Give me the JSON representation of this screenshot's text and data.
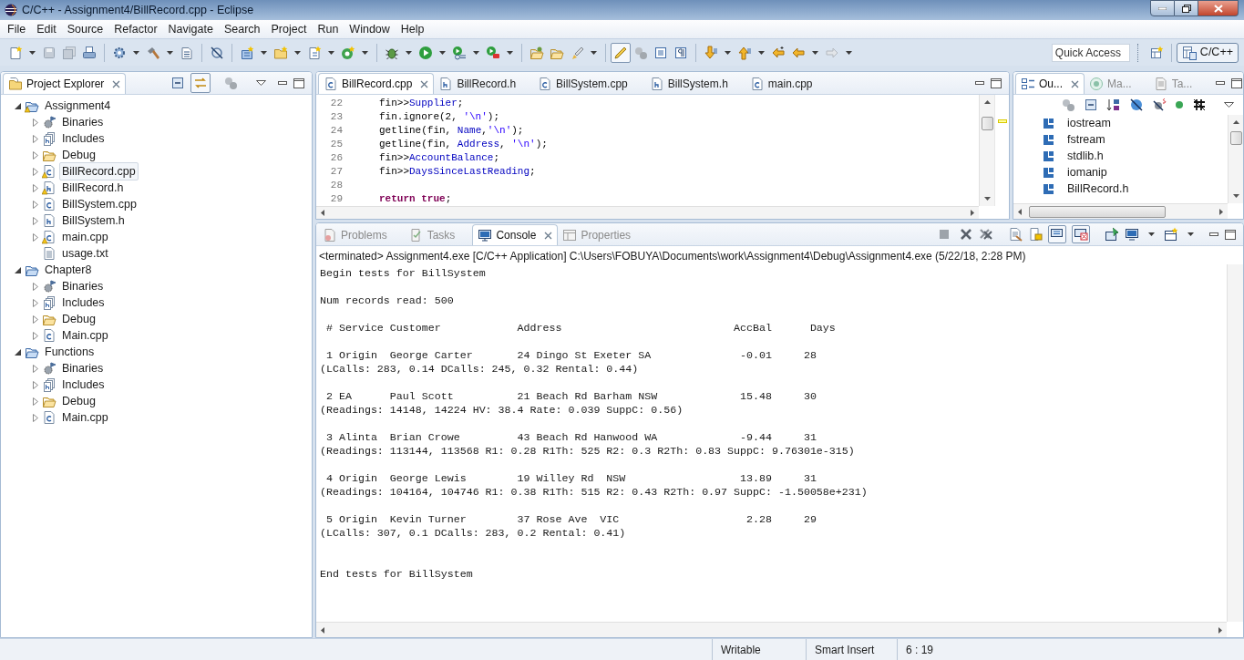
{
  "window": {
    "title": "C/C++ - Assignment4/BillRecord.cpp - Eclipse"
  },
  "menu": [
    "File",
    "Edit",
    "Source",
    "Refactor",
    "Navigate",
    "Search",
    "Project",
    "Run",
    "Window",
    "Help"
  ],
  "quick_access": {
    "placeholder": "Quick Access"
  },
  "perspective": {
    "label": "C/C++",
    "selected": true
  },
  "project_explorer": {
    "tabs": [
      {
        "label": "Project Explorer",
        "selected": true
      }
    ],
    "tree": [
      {
        "label": "Assignment4",
        "kind": "project",
        "warning": true,
        "expandable": true,
        "expanded": true,
        "selected": false,
        "children": [
          {
            "label": "Binaries",
            "kind": "binaries",
            "warning": false,
            "expandable": true,
            "expanded": false,
            "selected": false
          },
          {
            "label": "Includes",
            "kind": "includes",
            "warning": false,
            "expandable": true,
            "expanded": false,
            "selected": false
          },
          {
            "label": "Debug",
            "kind": "folder",
            "warning": false,
            "expandable": true,
            "expanded": false,
            "selected": false
          },
          {
            "label": "BillRecord.cpp",
            "kind": "source",
            "warning": true,
            "expandable": true,
            "expanded": false,
            "selected": true
          },
          {
            "label": "BillRecord.h",
            "kind": "header",
            "warning": true,
            "expandable": true,
            "expanded": false,
            "selected": false
          },
          {
            "label": "BillSystem.cpp",
            "kind": "source",
            "warning": false,
            "expandable": true,
            "expanded": false,
            "selected": false
          },
          {
            "label": "BillSystem.h",
            "kind": "header",
            "warning": false,
            "expandable": true,
            "expanded": false,
            "selected": false
          },
          {
            "label": "main.cpp",
            "kind": "source",
            "warning": true,
            "expandable": true,
            "expanded": false,
            "selected": false
          },
          {
            "label": "usage.txt",
            "kind": "text",
            "warning": false,
            "expandable": false,
            "selected": false
          }
        ]
      },
      {
        "label": "Chapter8",
        "kind": "project",
        "warning": false,
        "expandable": true,
        "expanded": true,
        "selected": false,
        "children": [
          {
            "label": "Binaries",
            "kind": "binaries",
            "warning": false,
            "expandable": true,
            "expanded": false,
            "selected": false
          },
          {
            "label": "Includes",
            "kind": "includes",
            "warning": false,
            "expandable": true,
            "expanded": false,
            "selected": false
          },
          {
            "label": "Debug",
            "kind": "folder",
            "warning": false,
            "expandable": true,
            "expanded": false,
            "selected": false
          },
          {
            "label": "Main.cpp",
            "kind": "source",
            "warning": false,
            "expandable": true,
            "expanded": false,
            "selected": false
          }
        ]
      },
      {
        "label": "Functions",
        "kind": "project",
        "warning": false,
        "expandable": true,
        "expanded": true,
        "selected": false,
        "children": [
          {
            "label": "Binaries",
            "kind": "binaries",
            "warning": false,
            "expandable": true,
            "expanded": false,
            "selected": false
          },
          {
            "label": "Includes",
            "kind": "includes",
            "warning": false,
            "expandable": true,
            "expanded": false,
            "selected": false
          },
          {
            "label": "Debug",
            "kind": "folder",
            "warning": false,
            "expandable": true,
            "expanded": false,
            "selected": false
          },
          {
            "label": "Main.cpp",
            "kind": "source",
            "warning": false,
            "expandable": true,
            "expanded": false,
            "selected": false
          }
        ]
      }
    ]
  },
  "editor": {
    "tabs": [
      {
        "label": "BillRecord.cpp",
        "kind": "source",
        "selected": true
      },
      {
        "label": "BillRecord.h",
        "kind": "header",
        "selected": false
      },
      {
        "label": "BillSystem.cpp",
        "kind": "source",
        "selected": false
      },
      {
        "label": "BillSystem.h",
        "kind": "header",
        "selected": false
      },
      {
        "label": "main.cpp",
        "kind": "source",
        "selected": false
      }
    ],
    "lines": [
      {
        "number": "22",
        "segments": [
          {
            "text": "fin>>",
            "kind": "plain"
          },
          {
            "text": "Supplier",
            "kind": "field"
          },
          {
            "text": ";",
            "kind": "plain"
          }
        ]
      },
      {
        "number": "23",
        "segments": [
          {
            "text": "fin.ignore(2, ",
            "kind": "plain"
          },
          {
            "text": "'\\n'",
            "kind": "string"
          },
          {
            "text": ");",
            "kind": "plain"
          }
        ]
      },
      {
        "number": "24",
        "segments": [
          {
            "text": "getline(fin, ",
            "kind": "plain"
          },
          {
            "text": "Name",
            "kind": "field"
          },
          {
            "text": ",",
            "kind": "plain"
          },
          {
            "text": "'\\n'",
            "kind": "string"
          },
          {
            "text": ");",
            "kind": "plain"
          }
        ]
      },
      {
        "number": "25",
        "segments": [
          {
            "text": "getline(fin, ",
            "kind": "plain"
          },
          {
            "text": "Address",
            "kind": "field"
          },
          {
            "text": ", ",
            "kind": "plain"
          },
          {
            "text": "'\\n'",
            "kind": "string"
          },
          {
            "text": ");",
            "kind": "plain"
          }
        ]
      },
      {
        "number": "26",
        "segments": [
          {
            "text": "fin>>",
            "kind": "plain"
          },
          {
            "text": "AccountBalance",
            "kind": "field"
          },
          {
            "text": ";",
            "kind": "plain"
          }
        ]
      },
      {
        "number": "27",
        "segments": [
          {
            "text": "fin>>",
            "kind": "plain"
          },
          {
            "text": "DaysSinceLastReading",
            "kind": "field"
          },
          {
            "text": ";",
            "kind": "plain"
          }
        ]
      },
      {
        "number": "28"
      },
      {
        "number": "29",
        "segments": [
          {
            "text": "return true",
            "kind": "keyword"
          },
          {
            "text": ";",
            "kind": "plain"
          }
        ]
      }
    ]
  },
  "outline": {
    "tabs": [
      {
        "label": "Ou...",
        "selected": true
      },
      {
        "label": "Ma...",
        "selected": false
      },
      {
        "label": "Ta...",
        "selected": false
      }
    ],
    "items": [
      "iostream",
      "fstream",
      "stdlib.h",
      "iomanip",
      "BillRecord.h"
    ]
  },
  "console": {
    "tabs": [
      {
        "label": "Problems",
        "selected": false
      },
      {
        "label": "Tasks",
        "selected": false
      },
      {
        "label": "Console",
        "selected": true
      },
      {
        "label": "Properties",
        "selected": false
      }
    ],
    "header": "<terminated> Assignment4.exe [C/C++ Application] C:\\Users\\FOBUYA\\Documents\\work\\Assignment4\\Debug\\Assignment4.exe (5/22/18, 2:28 PM)",
    "output": "Begin tests for BillSystem\n\nNum records read: 500\n\n # Service Customer            Address                           AccBal      Days\n\n 1 Origin  George Carter       24 Dingo St Exeter SA              -0.01     28\n(LCalls: 283, 0.14 DCalls: 245, 0.32 Rental: 0.44)\n\n 2 EA      Paul Scott          21 Beach Rd Barham NSW             15.48     30\n(Readings: 14148, 14224 HV: 38.4 Rate: 0.039 SuppC: 0.56)\n\n 3 Alinta  Brian Crowe         43 Beach Rd Hanwood WA             -9.44     31\n(Readings: 113144, 113568 R1: 0.28 R1Th: 525 R2: 0.3 R2Th: 0.83 SuppC: 9.76301e-315)\n\n 4 Origin  George Lewis        19 Willey Rd  NSW                  13.89     31\n(Readings: 104164, 104746 R1: 0.38 R1Th: 515 R2: 0.43 R2Th: 0.97 SuppC: -1.50058e+231)\n\n 5 Origin  Kevin Turner        37 Rose Ave  VIC                    2.28     29\n(LCalls: 307, 0.1 DCalls: 283, 0.2 Rental: 0.41)\n\n\nEnd tests for BillSystem"
  },
  "status_bar": [
    "Writable",
    "Smart Insert",
    "6 : 19"
  ]
}
